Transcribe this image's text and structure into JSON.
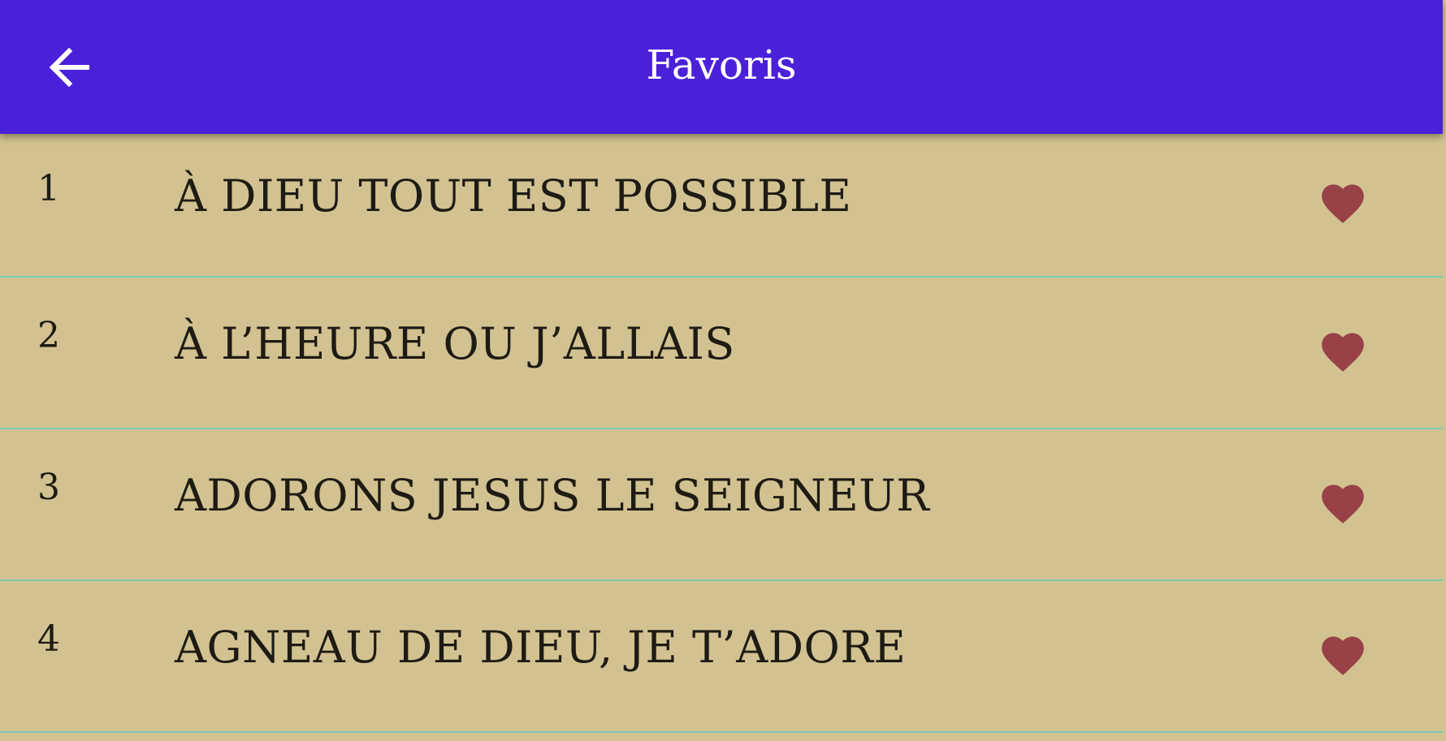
{
  "header": {
    "title": "Favoris",
    "back_icon": "arrow-left-icon",
    "background_color": "#4b20d9"
  },
  "favorites": [
    {
      "number": "1",
      "title": "À DIEU TOUT EST POSSIBLE",
      "icon": "heart-icon"
    },
    {
      "number": "2",
      "title": "À L’HEURE OU J’ALLAIS",
      "icon": "heart-icon"
    },
    {
      "number": "3",
      "title": "ADORONS JESUS LE SEIGNEUR",
      "icon": "heart-icon"
    },
    {
      "number": "4",
      "title": "AGNEAU DE DIEU, JE T’ADORE",
      "icon": "heart-icon"
    }
  ],
  "colors": {
    "background": "#d2c291",
    "heart": "#984147",
    "divider": "#7fc8b3",
    "text": "#1e1b14"
  }
}
